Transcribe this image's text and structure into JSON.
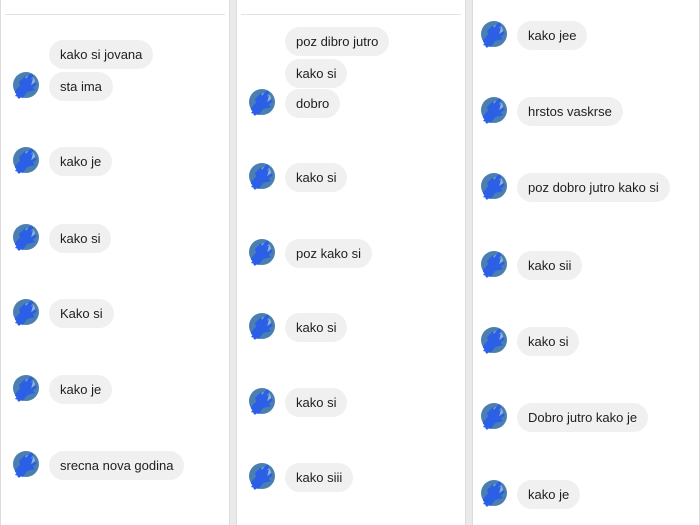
{
  "panels": [
    {
      "messages": [
        "kako si jovana",
        "sta ima",
        "kako je",
        "kako si",
        "Kako si",
        "kako je",
        "srecna nova godina"
      ]
    },
    {
      "messages": [
        "poz dibro jutro",
        "kako si",
        "dobro",
        "kako si",
        "poz kako si",
        "kako si",
        "kako si",
        "kako siii"
      ]
    },
    {
      "messages": [
        "kako jee",
        "hrstos vaskrse",
        "poz dobro jutro kako si",
        "kako sii",
        "kako si",
        "Dobro jutro kako je",
        "kako je"
      ]
    }
  ],
  "colors": {
    "bubble": "#f0f0f0",
    "avatar_fill": "#2b5fe6",
    "avatar_bg": "#4a7fb0",
    "text": "#1c1e21"
  },
  "icons": {
    "avatar": "profile-avatar-icon"
  }
}
